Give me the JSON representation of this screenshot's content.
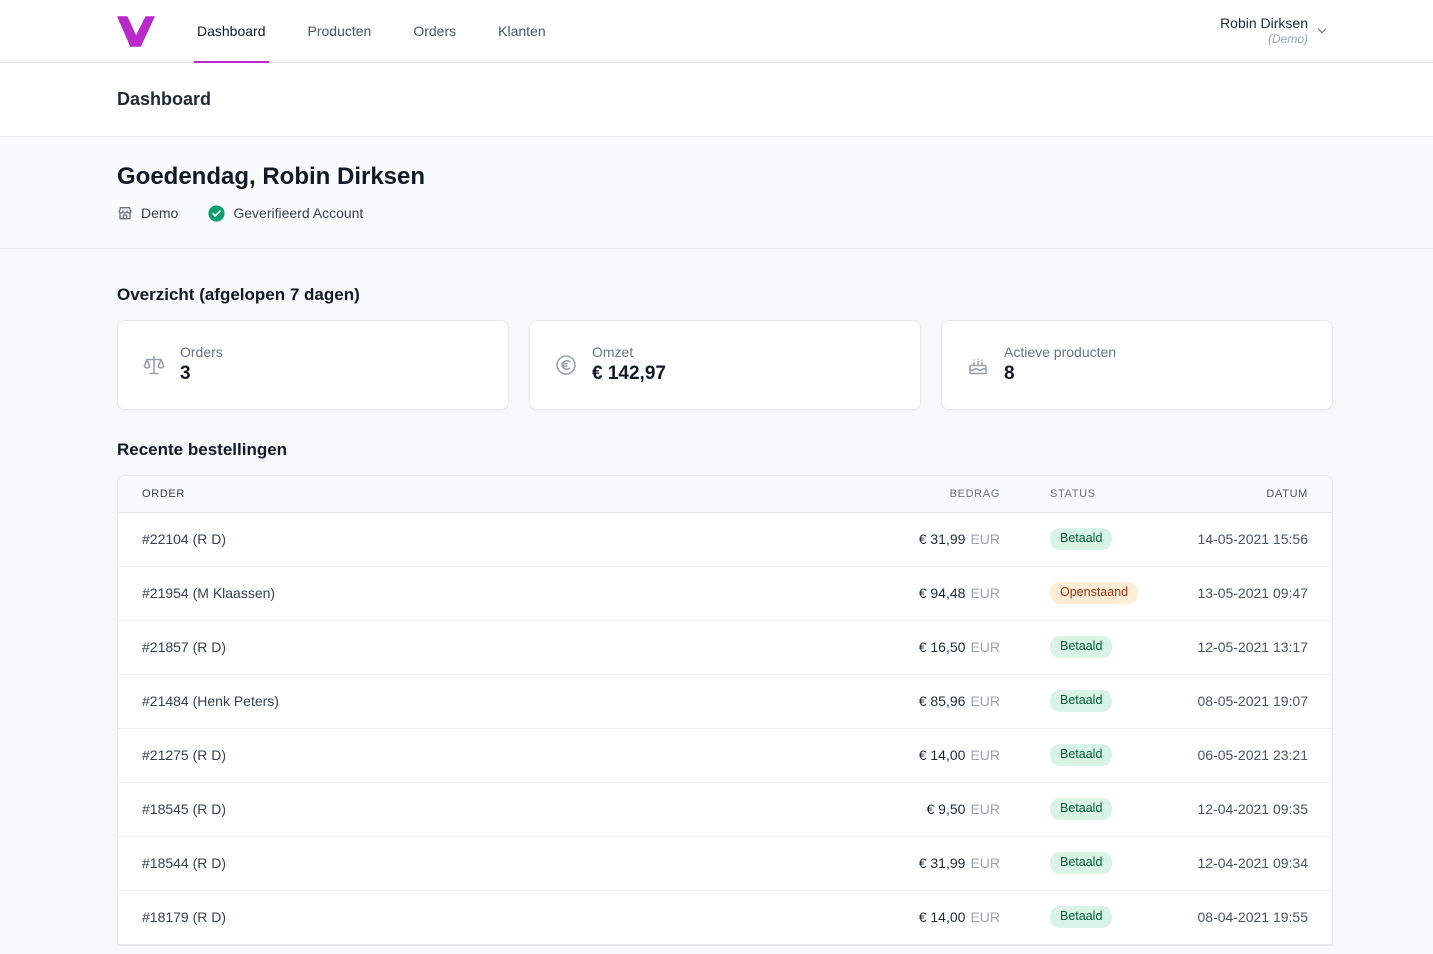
{
  "colors": {
    "accent": "#b829c9",
    "verified_green": "#0e9f6e",
    "paid_bg": "#d9f3e6",
    "paid_text": "#05603a",
    "open_bg": "#ffedd5",
    "open_text": "#9a3412"
  },
  "nav": {
    "items": [
      {
        "label": "Dashboard",
        "active": true
      },
      {
        "label": "Producten",
        "active": false
      },
      {
        "label": "Orders",
        "active": false
      },
      {
        "label": "Klanten",
        "active": false
      }
    ],
    "user": {
      "name": "Robin Dirksen",
      "subtitle": "(Demo)"
    }
  },
  "page": {
    "title": "Dashboard"
  },
  "greeting": {
    "title": "Goedendag, Robin Dirksen",
    "shop_name": "Demo",
    "verified_label": "Geverifieerd Account"
  },
  "overview": {
    "title": "Overzicht (afgelopen 7 dagen)",
    "cards": [
      {
        "label": "Orders",
        "value": "3",
        "icon": "scale-icon"
      },
      {
        "label": "Omzet",
        "value": "€ 142,97",
        "icon": "euro-circle-icon"
      },
      {
        "label": "Actieve producten",
        "value": "8",
        "icon": "cake-icon"
      }
    ]
  },
  "orders": {
    "title": "Recente bestellingen",
    "columns": [
      "ORDER",
      "BEDRAG",
      "STATUS",
      "DATUM"
    ],
    "rows": [
      {
        "order": "#22104 (R D)",
        "amount": "€ 31,99",
        "currency": "EUR",
        "status": "Betaald",
        "status_type": "paid",
        "date": "14-05-2021 15:56"
      },
      {
        "order": "#21954 (M Klaassen)",
        "amount": "€ 94,48",
        "currency": "EUR",
        "status": "Openstaand",
        "status_type": "open",
        "date": "13-05-2021 09:47"
      },
      {
        "order": "#21857 (R D)",
        "amount": "€ 16,50",
        "currency": "EUR",
        "status": "Betaald",
        "status_type": "paid",
        "date": "12-05-2021 13:17"
      },
      {
        "order": "#21484 (Henk Peters)",
        "amount": "€ 85,96",
        "currency": "EUR",
        "status": "Betaald",
        "status_type": "paid",
        "date": "08-05-2021 19:07"
      },
      {
        "order": "#21275 (R D)",
        "amount": "€ 14,00",
        "currency": "EUR",
        "status": "Betaald",
        "status_type": "paid",
        "date": "06-05-2021 23:21"
      },
      {
        "order": "#18545 (R D)",
        "amount": "€ 9,50",
        "currency": "EUR",
        "status": "Betaald",
        "status_type": "paid",
        "date": "12-04-2021 09:35"
      },
      {
        "order": "#18544 (R D)",
        "amount": "€ 31,99",
        "currency": "EUR",
        "status": "Betaald",
        "status_type": "paid",
        "date": "12-04-2021 09:34"
      },
      {
        "order": "#18179 (R D)",
        "amount": "€ 14,00",
        "currency": "EUR",
        "status": "Betaald",
        "status_type": "paid",
        "date": "08-04-2021 19:55"
      }
    ]
  }
}
